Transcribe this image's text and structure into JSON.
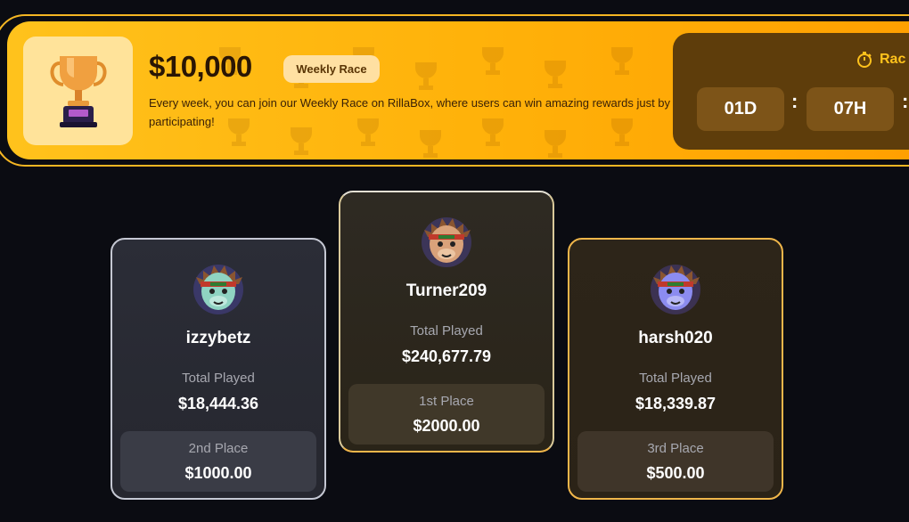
{
  "banner": {
    "prize": "$10,000",
    "badge": "Weekly Race",
    "description": "Every week, you can join our Weekly Race on RillaBox, where users can win amazing rewards just by participating!",
    "timer": {
      "label": "Rac",
      "icon": "stopwatch-icon",
      "days": "01D",
      "hours": "07H",
      "separator": ":"
    },
    "trophy_icon": "trophy-icon"
  },
  "leaderboard": {
    "total_played_label": "Total Played",
    "first": {
      "username": "Turner209",
      "total_played": "$240,677.79",
      "place": "1st Place",
      "prize": "$2000.00",
      "avatar_color": "#d9a27a"
    },
    "second": {
      "username": "izzybetz",
      "total_played": "$18,444.36",
      "place": "2nd Place",
      "prize": "$1000.00",
      "avatar_color": "#8fd3c2"
    },
    "third": {
      "username": "harsh020",
      "total_played": "$18,339.87",
      "place": "3rd Place",
      "prize": "$500.00",
      "avatar_color": "#8c8cf0"
    }
  },
  "colors": {
    "accent": "#ffb20a",
    "gold_border": "#f0b64a",
    "silver_border": "#c5c8d3",
    "background": "#0b0c12"
  }
}
